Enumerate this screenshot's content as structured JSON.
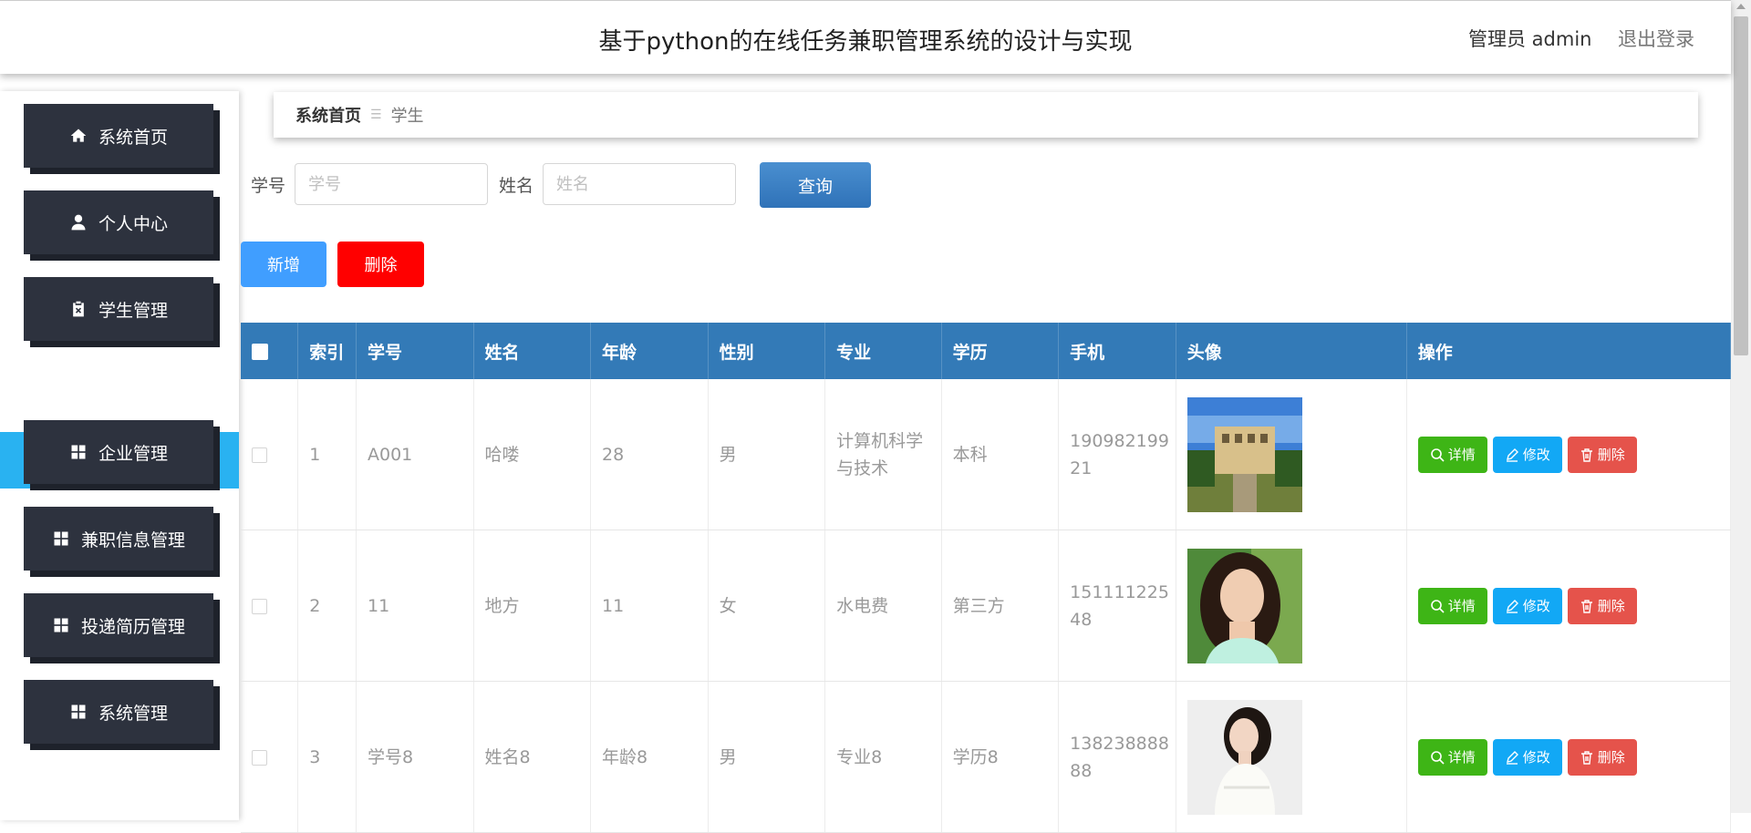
{
  "header": {
    "title": "基于python的在线任务兼职管理系统的设计与实现",
    "admin_label": "管理员 admin",
    "logout_label": "退出登录"
  },
  "sidebar": {
    "items": [
      {
        "label": "系统首页",
        "icon": "home-icon"
      },
      {
        "label": "个人中心",
        "icon": "user-icon"
      },
      {
        "label": "学生管理",
        "icon": "clipboard-icon"
      },
      {
        "label": "企业管理",
        "icon": "grid-icon"
      },
      {
        "label": "兼职信息管理",
        "icon": "grid-icon"
      },
      {
        "label": "投递简历管理",
        "icon": "grid-icon"
      },
      {
        "label": "系统管理",
        "icon": "grid-icon"
      }
    ],
    "active_sub": "学生"
  },
  "breadcrumb": {
    "home": "系统首页",
    "separator": "☰",
    "current": "学生"
  },
  "search": {
    "student_no_label": "学号",
    "student_no_placeholder": "学号",
    "name_label": "姓名",
    "name_placeholder": "姓名",
    "query_label": "查询"
  },
  "toolbar": {
    "add_label": "新增",
    "delete_label": "删除"
  },
  "table": {
    "columns": [
      "索引",
      "学号",
      "姓名",
      "年龄",
      "性别",
      "专业",
      "学历",
      "手机",
      "头像",
      "操作"
    ],
    "rows": [
      {
        "index": "1",
        "student_no": "A001",
        "name": "哈喽",
        "age": "28",
        "gender": "男",
        "major": "计算机科学与技术",
        "education": "本科",
        "phone": "19098219921"
      },
      {
        "index": "2",
        "student_no": "11",
        "name": "地方",
        "age": "11",
        "gender": "女",
        "major": "水电费",
        "education": "第三方",
        "phone": "15111122548"
      },
      {
        "index": "3",
        "student_no": "学号8",
        "name": "姓名8",
        "age": "年龄8",
        "gender": "男",
        "major": "专业8",
        "education": "学历8",
        "phone": "13823888888"
      }
    ],
    "actions": {
      "detail": "详情",
      "edit": "修改",
      "delete": "删除"
    }
  },
  "colors": {
    "sidebar_button": "#2d323e",
    "sidebar_active": "#29b2f1",
    "table_header": "#337ab7",
    "add_button": "#409eff",
    "delete_button": "#ff0000",
    "detail_button": "#3eb516",
    "edit_button": "#12a8f5",
    "row_delete_button": "#e5534b"
  }
}
